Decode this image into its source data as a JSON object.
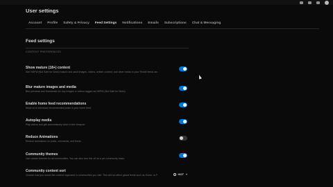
{
  "page_title": "User settings",
  "tabs": [
    {
      "label": "Account"
    },
    {
      "label": "Profile"
    },
    {
      "label": "Safety & Privacy"
    },
    {
      "label": "Feed Settings",
      "active": true
    },
    {
      "label": "Notifications"
    },
    {
      "label": "Emails"
    },
    {
      "label": "Subscriptions"
    },
    {
      "label": "Chat & Messaging"
    }
  ],
  "section": {
    "title": "Feed settings",
    "subheader": "CONTENT PREFERENCES"
  },
  "settings": [
    {
      "title": "Show mature (18+) content",
      "desc": "See NSFW (Not Safe for Work) mature and adult images, videos, written content, and other media in your Reddit feeds and search results.",
      "on": true
    },
    {
      "title": "Blur mature images and media",
      "desc": "Blur previews and thumbnails for any images or videos tagged as NSFW (Not Safe for Work).",
      "on": true
    },
    {
      "title": "Enable home feed recommendations",
      "desc": "Allow us to introduce recommended posts in your home feed.",
      "on": true
    },
    {
      "title": "Autoplay media",
      "desc": "Play videos and gifs automatically when in the viewport.",
      "on": true
    },
    {
      "title": "Reduce Animations",
      "desc": "Reduce animations on posts, comments, and feeds.",
      "on": false
    },
    {
      "title": "Community themes",
      "desc": "Use custom themes for all communities. You can also turn this off on a per community basis.",
      "on": true
    },
    {
      "title": "Community content sort",
      "desc": "Choose how you would like content organized in communities you visit. This will not affect global feeds such as Home, or Popular.",
      "select_value": "HOT"
    }
  ],
  "colors": {
    "accent": "#0079d3",
    "background": "#0a0a0a"
  }
}
